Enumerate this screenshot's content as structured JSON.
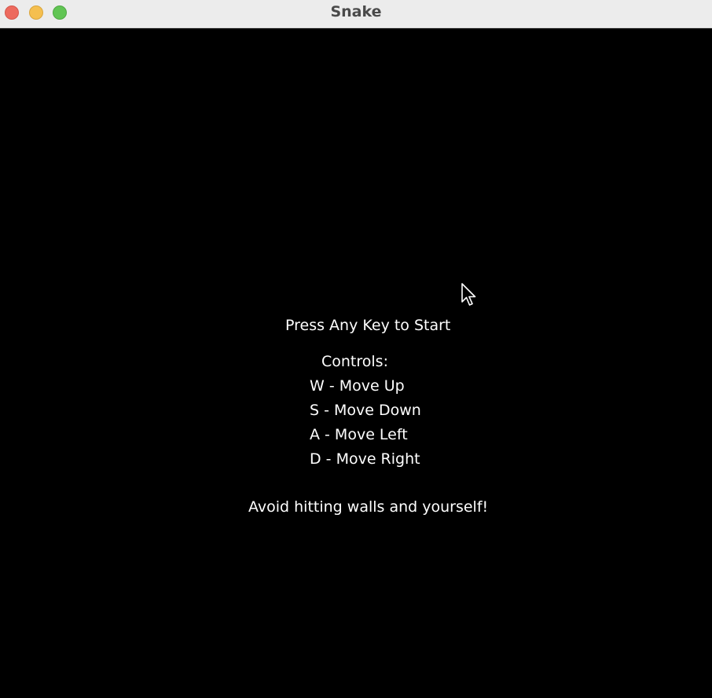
{
  "window": {
    "title": "Snake"
  },
  "screen": {
    "start_prompt": "Press Any Key to Start",
    "controls_heading": "Controls:",
    "controls": [
      "W - Move Up",
      "S - Move Down",
      "A - Move Left",
      "D - Move Right"
    ],
    "warning": "Avoid hitting walls and yourself!"
  },
  "colors": {
    "background": "#000000",
    "text": "#ffffff",
    "titlebar": "#ececec",
    "close": "#ed6a5e",
    "minimize": "#f5bf4f",
    "maximize": "#61c554"
  },
  "icons": {
    "cursor": "mouse-pointer-icon"
  }
}
